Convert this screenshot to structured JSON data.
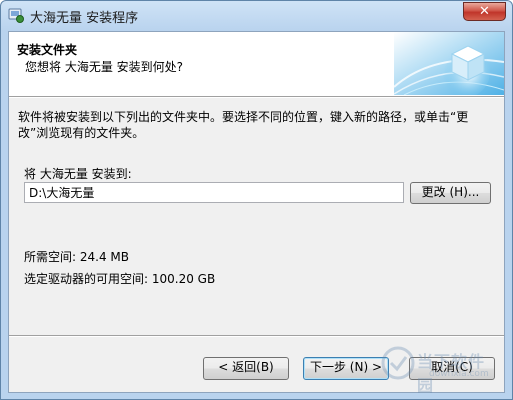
{
  "window": {
    "title": "大海无量 安装程序",
    "close_glyph": "✕"
  },
  "header": {
    "title": "安装文件夹",
    "subtitle": "您想将 大海无量 安装到何处?"
  },
  "body": {
    "description": "软件将被安装到以下列出的文件夹中。要选择不同的位置，键入新的路径，或单击“更改”浏览现有的文件夹。",
    "install_label": "将 大海无量 安装到:",
    "install_path": "D:\\大海无量",
    "change_button": "更改 (H)...",
    "space_required": "所需空间: 24.4 MB",
    "space_available": "选定驱动器的可用空间: 100.20 GB"
  },
  "footer": {
    "back_button": "< 返回(B)",
    "next_button": "下一步 (N) >",
    "cancel_button": "取消(C)"
  },
  "watermark": {
    "text": "当下软件园",
    "url": "downxia.com"
  },
  "colors": {
    "title_bar": "#b9d3ee",
    "close_button": "#c0352a",
    "client_bg": "#f0f0f0",
    "default_button_border": "#3c7fb1"
  },
  "icons": [
    "setup-app-icon",
    "close-icon",
    "globe-cube-graphic"
  ]
}
